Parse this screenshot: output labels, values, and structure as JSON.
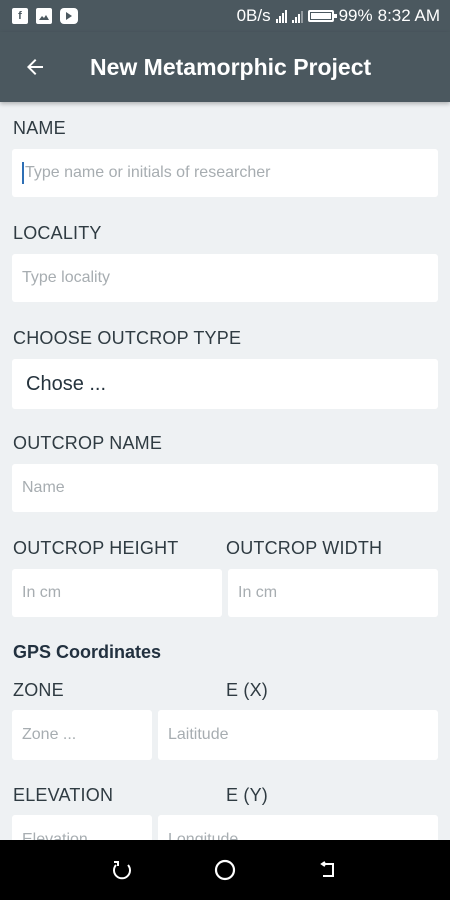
{
  "status_bar": {
    "notification_icons": [
      "facebook-icon",
      "image-icon",
      "youtube-icon"
    ],
    "network_speed": "0B/s",
    "battery": "99%",
    "time": "8:32 AM"
  },
  "app_bar": {
    "title": "New Metamorphic Project",
    "back_icon": "arrow-left-icon"
  },
  "form": {
    "name": {
      "label": "NAME",
      "placeholder": "Type name or initials of researcher"
    },
    "locality": {
      "label": "LOCALITY",
      "placeholder": "Type locality"
    },
    "outcrop_type": {
      "label": "CHOOSE OUTCROP TYPE",
      "value": "Chose ..."
    },
    "outcrop_name": {
      "label": "OUTCROP NAME",
      "placeholder": "Name"
    },
    "outcrop_height": {
      "label": "OUTCROP HEIGHT",
      "placeholder": "In cm"
    },
    "outcrop_width": {
      "label": "OUTCROP WIDTH",
      "placeholder": "In cm"
    },
    "gps": {
      "title": "GPS Coordinates",
      "zone": {
        "label": "ZONE",
        "placeholder": "Zone ..."
      },
      "ex": {
        "label": "E (X)",
        "placeholder": "Laititude"
      },
      "elevation": {
        "label": "ELEVATION",
        "placeholder": "Elevation"
      },
      "ey": {
        "label": "E (Y)",
        "placeholder": "Longitude"
      }
    }
  },
  "nav_bar": {
    "buttons": [
      "recent-apps-icon",
      "home-icon",
      "back-icon"
    ]
  },
  "colors": {
    "app_bar": "#4b585f",
    "background": "#eef1f3",
    "field": "#ffffff",
    "label": "#2f3b42",
    "nav_bar": "#000000"
  }
}
